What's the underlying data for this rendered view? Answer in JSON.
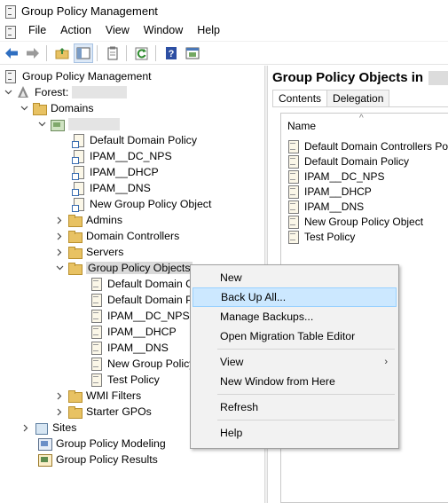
{
  "window": {
    "title": "Group Policy Management"
  },
  "menubar": {
    "items": [
      "File",
      "Action",
      "View",
      "Window",
      "Help"
    ]
  },
  "toolbar": {
    "buttons": [
      "back-icon",
      "forward-icon",
      "up-folder-icon",
      "show-hide-tree-icon",
      "properties-icon",
      "refresh-icon",
      "help-icon",
      "export-list-icon"
    ]
  },
  "tree": {
    "root": "Group Policy Management",
    "forest_label": "Forest:",
    "domains": "Domains",
    "linked_gpos": [
      "Default Domain Policy",
      "IPAM__DC_NPS",
      "IPAM__DHCP",
      "IPAM__DNS",
      "New Group Policy Object"
    ],
    "ous": [
      "Admins",
      "Domain Controllers",
      "Servers"
    ],
    "gpo_container": "Group Policy Objects",
    "gpo_children": [
      "Default Domain C",
      "Default Domain P",
      "IPAM__DC_NPS",
      "IPAM__DHCP",
      "IPAM__DNS",
      "New Group Policy",
      "Test Policy"
    ],
    "wmi_filters": "WMI Filters",
    "starter_gpos": "Starter GPOs",
    "sites": "Sites",
    "modeling": "Group Policy Modeling",
    "results": "Group Policy Results"
  },
  "right": {
    "title": "Group Policy Objects in",
    "tabs": [
      "Contents",
      "Delegation"
    ],
    "active_tab": "Contents",
    "column_header": "Name",
    "rows": [
      "Default Domain Controllers Policy",
      "Default Domain Policy",
      "IPAM__DC_NPS",
      "IPAM__DHCP",
      "IPAM__DNS",
      "New Group Policy Object",
      "Test Policy"
    ]
  },
  "context_menu": {
    "new": "New",
    "backup_all": "Back Up All...",
    "manage_backups": "Manage Backups...",
    "migration_editor": "Open Migration Table Editor",
    "view": "View",
    "view_arrow": "›",
    "new_window": "New Window from Here",
    "refresh": "Refresh",
    "help": "Help",
    "highlighted": "Back Up All..."
  },
  "colors": {
    "highlight": "#cce8ff",
    "highlight_border": "#99d1ff",
    "menu_bg": "#f2f2f2",
    "folder": "#e8c263"
  }
}
